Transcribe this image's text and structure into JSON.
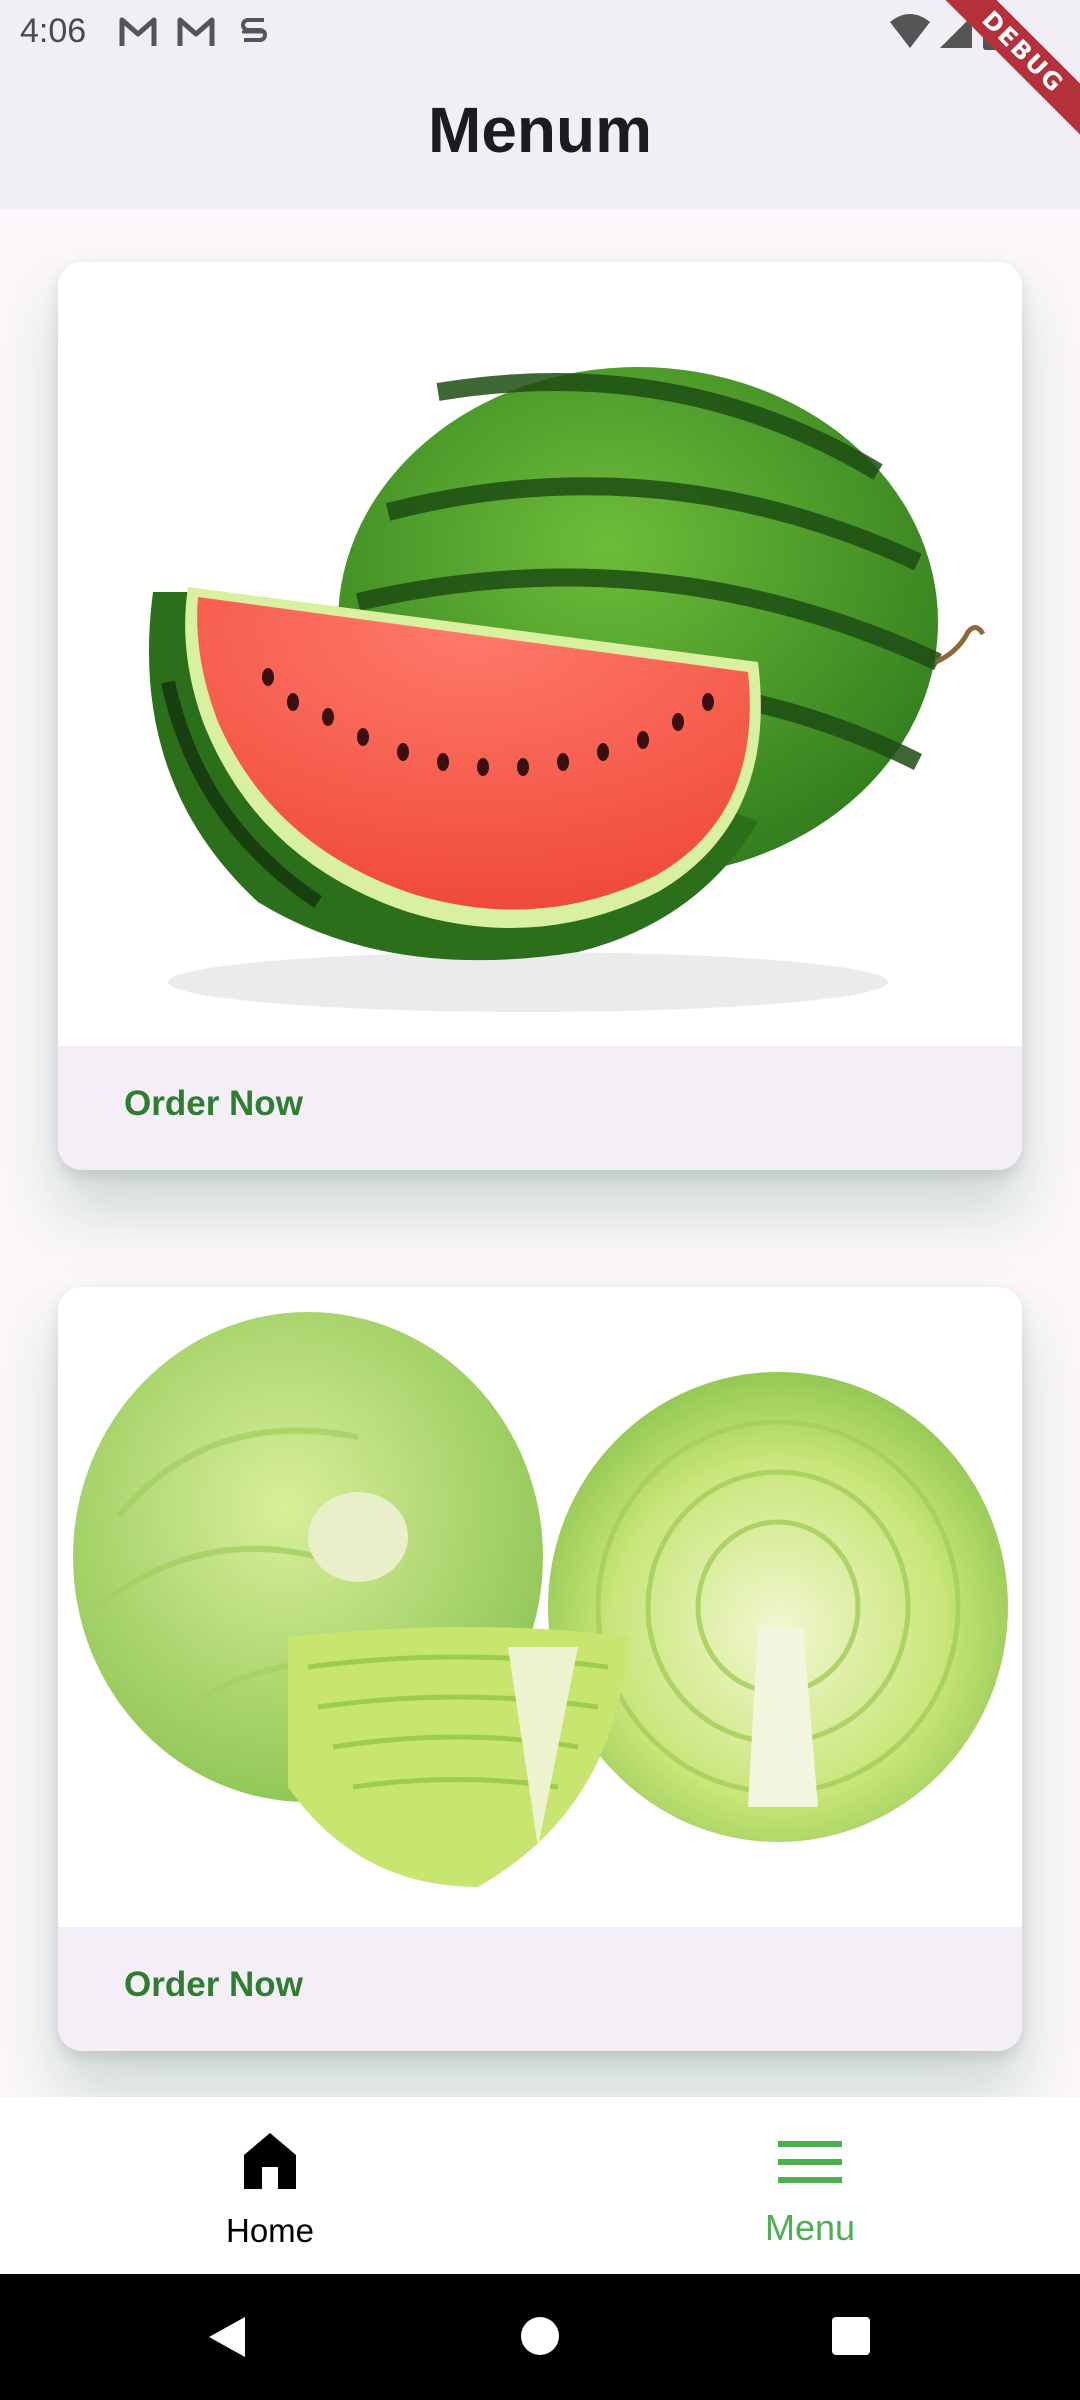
{
  "status_bar": {
    "time": "4:06",
    "notification_icons": [
      "gmail-icon",
      "gmail-icon",
      "app-notification-icon"
    ],
    "right_icons": [
      "wifi-icon",
      "signal-icon",
      "battery-icon"
    ]
  },
  "debug_banner": "DEBUG",
  "app_bar": {
    "title": "Menum"
  },
  "cards": [
    {
      "image": "watermelon-image",
      "action_label": "Order Now"
    },
    {
      "image": "cabbage-image",
      "action_label": "Order Now"
    }
  ],
  "bottom_nav": {
    "items": [
      {
        "label": "Home",
        "icon": "home-icon",
        "selected": false
      },
      {
        "label": "Menu",
        "icon": "menu-icon",
        "selected": true
      }
    ],
    "selected_color": "#4caf50",
    "unselected_color": "#000000"
  },
  "colors": {
    "accent_green": "#2e7d32",
    "app_bar_bg": "#f1eff5",
    "page_bg": "#fbf7fb"
  }
}
